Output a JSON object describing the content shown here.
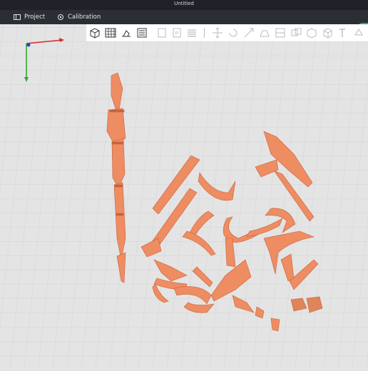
{
  "window": {
    "title": "Untitled"
  },
  "tabs": [
    {
      "label": "Project",
      "icon": "project-icon"
    },
    {
      "label": "Calibration",
      "icon": "calibration-icon"
    }
  ],
  "toolbar": {
    "tools": [
      "add-object-icon",
      "auto-arrange-icon",
      "auto-orient-icon",
      "plate-icon",
      "copy-icon",
      "paste-icon",
      "layers-icon",
      "move-icon",
      "rotate-icon",
      "scale-icon",
      "lay-on-face-icon",
      "cut-icon",
      "split-objects-icon",
      "split-parts-icon",
      "assembly-icon",
      "text-icon",
      "support-paint-icon"
    ]
  },
  "colors": {
    "model": "#ee8c62",
    "model_shadow": "#c8633d",
    "grid": "#cfcfcf",
    "bg": "#e4e4e4",
    "axis_x": "#d42a2a",
    "axis_y": "#2fa82f",
    "axis_z": "#2440c8"
  }
}
